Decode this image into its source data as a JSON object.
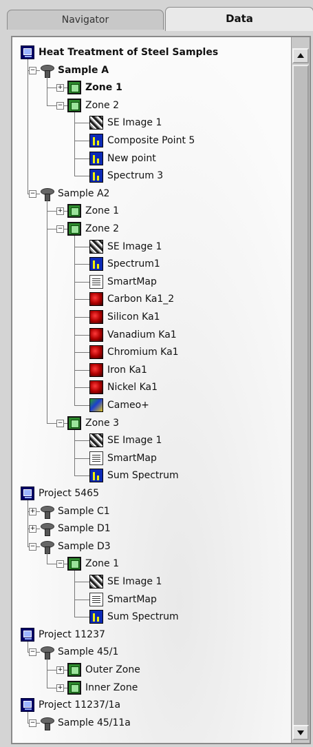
{
  "tabs": {
    "navigator": "Navigator",
    "data": "Data"
  },
  "tree": [
    {
      "label": "Heat Treatment of Steel Samples",
      "level": 0,
      "icon": "project",
      "bold": true
    },
    {
      "label": "Sample A",
      "level": 1,
      "icon": "sample",
      "bold": true,
      "expander": "minus"
    },
    {
      "label": "Zone 1",
      "level": 2,
      "icon": "zone",
      "bold": true,
      "expander": "plus"
    },
    {
      "label": "Zone 2",
      "level": 2,
      "icon": "zone",
      "expander": "minus"
    },
    {
      "label": "SE Image 1",
      "level": 3,
      "icon": "se-image"
    },
    {
      "label": "Composite Point 5",
      "level": 3,
      "icon": "spectrum"
    },
    {
      "label": "New point",
      "level": 3,
      "icon": "spectrum"
    },
    {
      "label": "Spectrum 3",
      "level": 3,
      "icon": "spectrum"
    },
    {
      "label": "Sample A2",
      "level": 1,
      "icon": "sample",
      "expander": "minus"
    },
    {
      "label": "Zone 1",
      "level": 2,
      "icon": "zone",
      "expander": "plus"
    },
    {
      "label": "Zone 2",
      "level": 2,
      "icon": "zone",
      "expander": "minus"
    },
    {
      "label": "SE Image 1",
      "level": 3,
      "icon": "se-image"
    },
    {
      "label": "Spectrum1",
      "level": 3,
      "icon": "spectrum"
    },
    {
      "label": "SmartMap",
      "level": 3,
      "icon": "smartmap"
    },
    {
      "label": "Carbon Ka1_2",
      "level": 3,
      "icon": "element-map"
    },
    {
      "label": "Silicon Ka1",
      "level": 3,
      "icon": "element-map"
    },
    {
      "label": "Vanadium Ka1",
      "level": 3,
      "icon": "element-map"
    },
    {
      "label": "Chromium Ka1",
      "level": 3,
      "icon": "element-map"
    },
    {
      "label": "Iron Ka1",
      "level": 3,
      "icon": "element-map"
    },
    {
      "label": "Nickel Ka1",
      "level": 3,
      "icon": "element-map"
    },
    {
      "label": "Cameo+",
      "level": 3,
      "icon": "cameo"
    },
    {
      "label": "Zone 3",
      "level": 2,
      "icon": "zone",
      "expander": "minus"
    },
    {
      "label": "SE Image 1",
      "level": 3,
      "icon": "se-image"
    },
    {
      "label": "SmartMap",
      "level": 3,
      "icon": "smartmap"
    },
    {
      "label": "Sum Spectrum",
      "level": 3,
      "icon": "spectrum"
    },
    {
      "label": "Project 5465",
      "level": 0,
      "icon": "project"
    },
    {
      "label": "Sample C1",
      "level": 1,
      "icon": "sample",
      "expander": "plus"
    },
    {
      "label": "Sample D1",
      "level": 1,
      "icon": "sample",
      "expander": "plus"
    },
    {
      "label": "Sample D3",
      "level": 1,
      "icon": "sample",
      "expander": "minus"
    },
    {
      "label": "Zone 1",
      "level": 2,
      "icon": "zone",
      "expander": "minus"
    },
    {
      "label": "SE Image 1",
      "level": 3,
      "icon": "se-image"
    },
    {
      "label": "SmartMap",
      "level": 3,
      "icon": "smartmap"
    },
    {
      "label": "Sum Spectrum",
      "level": 3,
      "icon": "spectrum"
    },
    {
      "label": "Project 11237",
      "level": 0,
      "icon": "project"
    },
    {
      "label": "Sample 45/1",
      "level": 1,
      "icon": "sample",
      "expander": "minus"
    },
    {
      "label": "Outer Zone",
      "level": 2,
      "icon": "zone",
      "expander": "plus"
    },
    {
      "label": "Inner Zone",
      "level": 2,
      "icon": "zone",
      "expander": "plus"
    },
    {
      "label": "Project 11237/1a",
      "level": 0,
      "icon": "project"
    },
    {
      "label": "Sample 45/11a",
      "level": 1,
      "icon": "sample",
      "expander": "minus"
    }
  ]
}
